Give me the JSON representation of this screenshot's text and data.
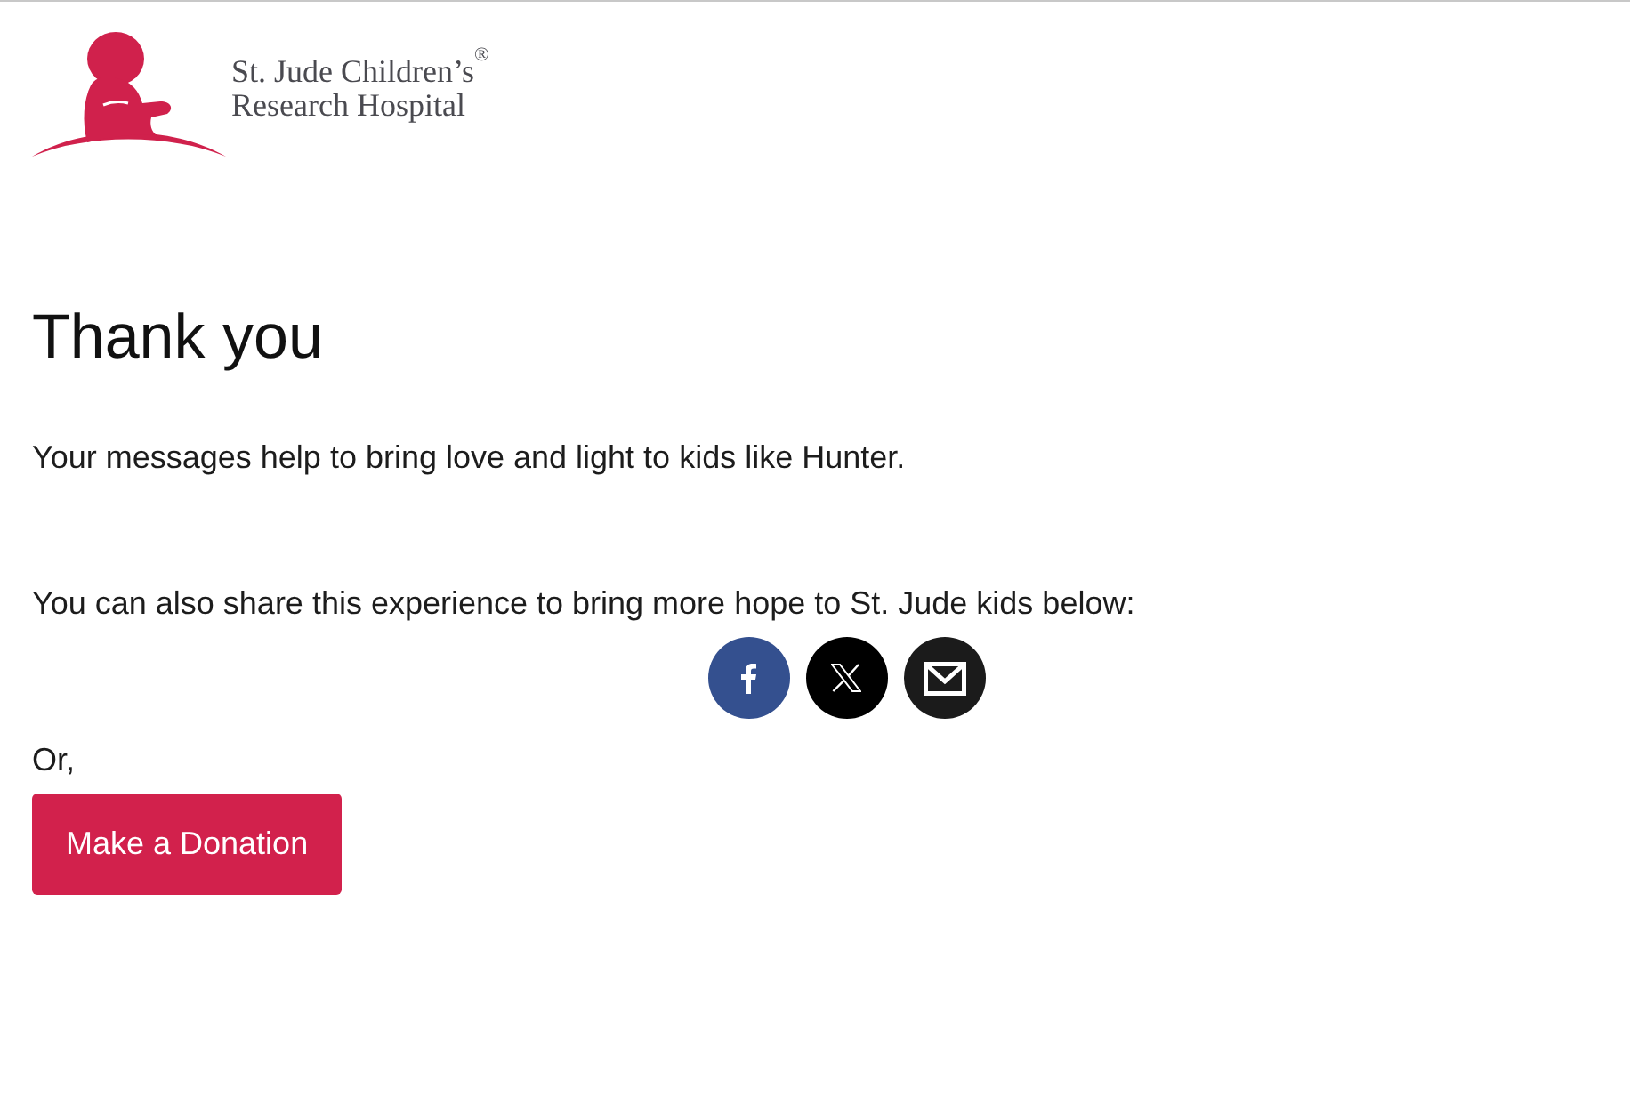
{
  "logo": {
    "line_1": "St. Jude Children’s",
    "line_2": "Research Hospital",
    "mark": "®"
  },
  "heading": "Thank you",
  "message": "Your messages help to bring love and light to kids like Hunter.",
  "share_prompt": "You can also share this experience to bring more hope to St. Jude kids below:",
  "share_buttons": [
    {
      "kind": "facebook"
    },
    {
      "kind": "x"
    },
    {
      "kind": "email"
    }
  ],
  "alternative": "Or,",
  "donate_button": "Make a Donation"
}
